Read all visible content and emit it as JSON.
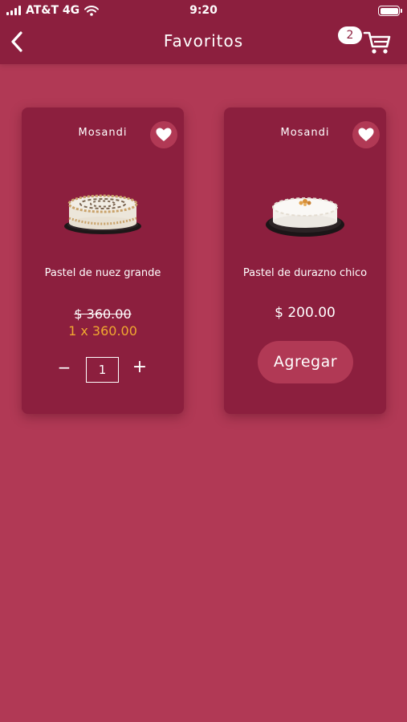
{
  "status_bar": {
    "carrier": "AT&T 4G",
    "time": "9:20"
  },
  "header": {
    "title": "Favoritos",
    "cart_count": "2",
    "back_icon": "chevron-left-icon",
    "cart_icon": "cart-icon"
  },
  "products": [
    {
      "brand": "Mosandi",
      "name": "Pastel de nuez grande",
      "original_price": "$ 360.00",
      "qty_price": "1 x 360.00",
      "quantity": "1",
      "minus_label": "−",
      "plus_label": "+"
    },
    {
      "brand": "Mosandi",
      "name": "Pastel de durazno chico",
      "price": "$ 200.00",
      "add_label": "Agregar"
    }
  ],
  "colors": {
    "background": "#b13955",
    "header": "#8c1f3e",
    "card": "#8c1f3e",
    "accent_price": "#f0a830",
    "text": "#ffffff"
  }
}
